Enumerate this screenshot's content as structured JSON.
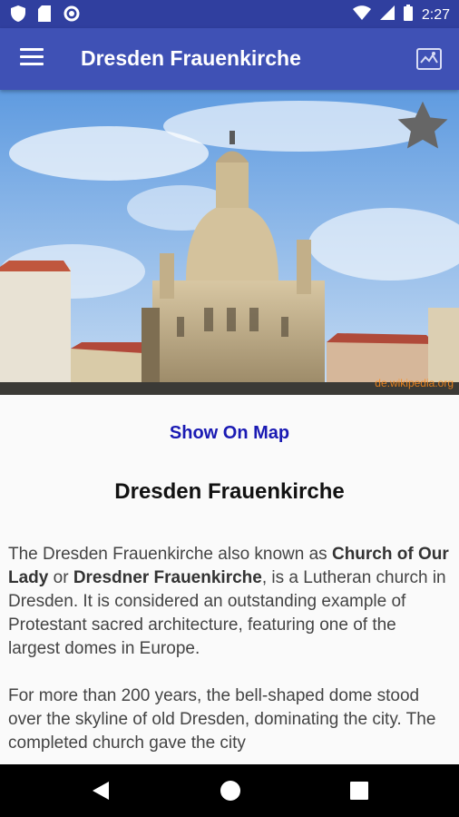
{
  "status_bar": {
    "time": "2:27",
    "left_icons": [
      "shield-icon",
      "sd-card-icon",
      "circle-icon"
    ],
    "right_icons": [
      "wifi-icon",
      "signal-icon",
      "battery-icon"
    ]
  },
  "app_bar": {
    "title": "Dresden Frauenkirche",
    "menu_icon": "hamburger-menu-icon",
    "map_icon": "map-icon",
    "color": "#3f51b5",
    "status_color": "#303f9f"
  },
  "hero": {
    "favorite_icon": "star-icon",
    "watermark": "de.wikipedia.org"
  },
  "content": {
    "show_on_map": "Show On Map",
    "title": "Dresden Frauenkirche",
    "p1": {
      "t1": "The Dresden Frauenkirche also known as ",
      "b1": "Church of Our Lady",
      "t2": " or ",
      "b2": "Dresdner Frauenkirche",
      "t3": ", is a Lutheran church in Dresden. It is considered an outstanding example of Protestant sacred architecture, featuring one of the largest domes in Europe."
    },
    "p2": "For more than 200 years, the bell-shaped dome stood over the skyline of old Dresden, dominating the city. The completed church gave the city"
  },
  "nav_bar": {
    "back_icon": "back-triangle-icon",
    "home_icon": "home-circle-icon",
    "recents_icon": "recents-square-icon"
  }
}
